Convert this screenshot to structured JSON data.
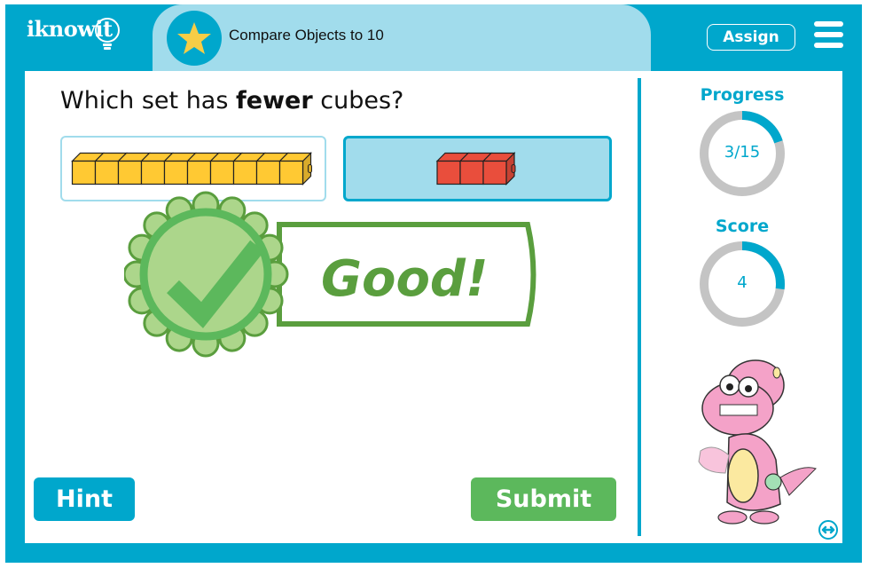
{
  "header": {
    "logo": "iknowit",
    "title": "Compare Objects to 10",
    "assign_label": "Assign",
    "menu_icon": "hamburger-menu-icon",
    "badge_icon": "star-icon"
  },
  "question": {
    "prefix": "Which set has ",
    "emphasis": "fewer",
    "suffix": " cubes?"
  },
  "choices": [
    {
      "id": "a",
      "cube_count": 10,
      "cube_color": "#ffc933",
      "selected": false
    },
    {
      "id": "b",
      "cube_count": 3,
      "cube_color": "#e94e3c",
      "selected": true
    }
  ],
  "feedback": {
    "text": "Good!",
    "icon": "checkmark-icon",
    "color": "#5a9e3e"
  },
  "sidebar": {
    "progress_label": "Progress",
    "progress_value": "3/15",
    "progress_fraction": 0.2,
    "score_label": "Score",
    "score_value": "4",
    "score_fraction": 0.27
  },
  "buttons": {
    "hint": "Hint",
    "submit": "Submit"
  },
  "colors": {
    "brand": "#00a7cc",
    "brand_light": "#a1dcec",
    "success": "#5cb85c",
    "ring_track": "#c4c4c4"
  }
}
